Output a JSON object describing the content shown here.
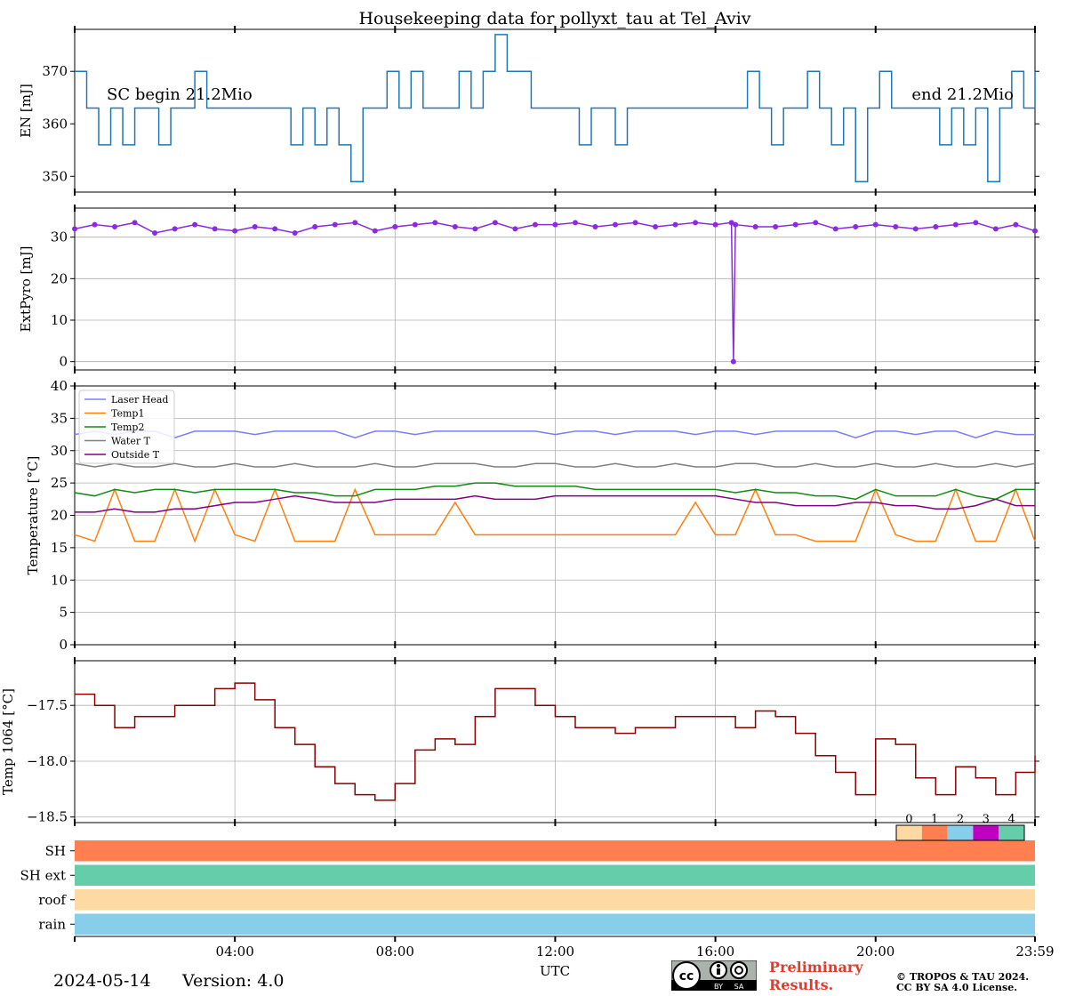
{
  "title": "Housekeeping data for pollyxt_tau at Tel_Aviv",
  "footer": {
    "date": "2024-05-14",
    "version": "Version: 4.0",
    "preliminary_line1": "Preliminary",
    "preliminary_line2": "Results.",
    "copyright_line1": "© TROPOS & TAU 2024.",
    "copyright_line2": "CC BY SA 4.0 License.",
    "license_badge": [
      "BY",
      "SA"
    ]
  },
  "colors": {
    "en": "#1f77b4",
    "pyro": "#8a2be2",
    "laser_head": "#7b7bff",
    "temp1": "#ff7f0e",
    "temp2": "#138a13",
    "water_t": "#808080",
    "outside_t": "#800080",
    "temp1064": "#8b0000",
    "status_0": "#fdd9a4",
    "status_1": "#ff7f50",
    "status_2": "#87ceeb",
    "status_3": "#c000c0",
    "status_4": "#66cdaa"
  },
  "chart_data": [
    {
      "type": "line",
      "id": "en",
      "ylabel": "EN [mJ]",
      "ylim": [
        347,
        378
      ],
      "yticks": [
        350,
        360,
        370
      ],
      "ytick_labels": [
        "350",
        "360",
        "370"
      ],
      "grid": false,
      "annotations": [
        "SC begin 21.2Mio",
        "end 21.2Mio"
      ],
      "x_hours": [
        0,
        0.3,
        0.6,
        0.9,
        1.2,
        1.5,
        1.8,
        2.1,
        2.4,
        2.7,
        3.0,
        3.3,
        3.6,
        3.9,
        4.2,
        4.5,
        4.8,
        5.1,
        5.4,
        5.7,
        6.0,
        6.3,
        6.6,
        6.9,
        7.2,
        7.5,
        7.8,
        8.1,
        8.4,
        8.7,
        9.0,
        9.3,
        9.6,
        9.9,
        10.2,
        10.5,
        10.8,
        11.1,
        11.4,
        11.7,
        12.0,
        12.3,
        12.6,
        12.9,
        13.2,
        13.5,
        13.8,
        14.1,
        14.4,
        14.7,
        15.0,
        15.3,
        15.6,
        15.9,
        16.2,
        16.5,
        16.8,
        17.1,
        17.4,
        17.7,
        18.0,
        18.3,
        18.6,
        18.9,
        19.2,
        19.5,
        19.8,
        20.1,
        20.4,
        20.7,
        21.0,
        21.3,
        21.6,
        21.9,
        22.2,
        22.5,
        22.8,
        23.1,
        23.4,
        23.7,
        23.98
      ],
      "values": [
        370,
        363,
        356,
        363,
        356,
        363,
        363,
        356,
        363,
        363,
        370,
        363,
        363,
        363,
        363,
        363,
        363,
        363,
        356,
        363,
        356,
        363,
        356,
        349,
        363,
        363,
        370,
        363,
        370,
        363,
        363,
        363,
        370,
        363,
        370,
        377,
        370,
        370,
        363,
        363,
        363,
        363,
        356,
        363,
        363,
        356,
        363,
        363,
        363,
        363,
        363,
        363,
        363,
        363,
        363,
        363,
        370,
        363,
        356,
        363,
        363,
        370,
        363,
        356,
        363,
        349,
        363,
        370,
        363,
        363,
        363,
        363,
        356,
        363,
        356,
        363,
        349,
        363,
        370,
        363,
        370
      ]
    },
    {
      "type": "scatter",
      "id": "pyro",
      "ylabel": "ExtPyro [mJ]",
      "ylim": [
        -2,
        37
      ],
      "yticks": [
        0,
        10,
        20,
        30
      ],
      "ytick_labels": [
        "0",
        "10",
        "20",
        "30"
      ],
      "grid": true,
      "x_hours": [
        0,
        0.5,
        1.0,
        1.5,
        2.0,
        2.5,
        3.0,
        3.5,
        4.0,
        4.5,
        5.0,
        5.5,
        6.0,
        6.5,
        7.0,
        7.5,
        8.0,
        8.5,
        9.0,
        9.5,
        10.0,
        10.5,
        11.0,
        11.5,
        12.0,
        12.5,
        13.0,
        13.5,
        14.0,
        14.5,
        15.0,
        15.5,
        16.0,
        16.4,
        16.45,
        16.5,
        17.0,
        17.5,
        18.0,
        18.5,
        19.0,
        19.5,
        20.0,
        20.5,
        21.0,
        21.5,
        22.0,
        22.5,
        23.0,
        23.5,
        23.98
      ],
      "values": [
        32.0,
        33.0,
        32.5,
        33.5,
        31.0,
        32.0,
        33.0,
        32.0,
        31.5,
        32.5,
        32.0,
        31.0,
        32.5,
        33.0,
        33.5,
        31.5,
        32.5,
        33.0,
        33.5,
        32.5,
        32.0,
        33.5,
        32.0,
        33.0,
        33.0,
        33.5,
        32.5,
        33.0,
        33.5,
        32.5,
        33.0,
        33.5,
        33.0,
        33.5,
        0,
        33.0,
        32.5,
        32.5,
        33.0,
        33.5,
        32.0,
        32.5,
        33.0,
        32.5,
        32.0,
        32.5,
        33.0,
        33.5,
        32.0,
        33.0,
        31.5
      ]
    },
    {
      "type": "line",
      "id": "temps",
      "ylabel": "Temperature [$^\\circ C$]",
      "ylim": [
        0,
        40
      ],
      "yticks": [
        0,
        5,
        10,
        15,
        20,
        25,
        30,
        35,
        40
      ],
      "ytick_labels": [
        "0",
        "5",
        "10",
        "15",
        "20",
        "25",
        "30",
        "35",
        "40"
      ],
      "grid": true,
      "legend": "top-left",
      "x_hours": [
        0,
        0.5,
        1.0,
        1.5,
        2.0,
        2.5,
        3.0,
        3.5,
        4.0,
        4.5,
        5.0,
        5.5,
        6.0,
        6.5,
        7.0,
        7.5,
        8.0,
        8.5,
        9.0,
        9.5,
        10.0,
        10.5,
        11.0,
        11.5,
        12.0,
        12.5,
        13.0,
        13.5,
        14.0,
        14.5,
        15.0,
        15.5,
        16.0,
        16.5,
        17.0,
        17.5,
        18.0,
        18.5,
        19.0,
        19.5,
        20.0,
        20.5,
        21.0,
        21.5,
        22.0,
        22.5,
        23.0,
        23.5,
        23.98
      ],
      "series": [
        {
          "name": "Laser Head",
          "color_key": "laser_head",
          "values": [
            32.5,
            33,
            32.5,
            33,
            33,
            32,
            33,
            33,
            33,
            32.5,
            33,
            33,
            33,
            33,
            32,
            33,
            33,
            32.5,
            33,
            33,
            33,
            33,
            33,
            33,
            32.5,
            33,
            33,
            32.5,
            33,
            33,
            33,
            32.5,
            33,
            33,
            32.5,
            33,
            33,
            33,
            33,
            32,
            33,
            33,
            32.5,
            33,
            33,
            32,
            33,
            32.5,
            32.5
          ]
        },
        {
          "name": "Temp1",
          "color_key": "temp1",
          "values": [
            17,
            16,
            24,
            16,
            16,
            24,
            16,
            24,
            17,
            16,
            24,
            16,
            16,
            16,
            24,
            17,
            17,
            17,
            17,
            22,
            17,
            17,
            17,
            17,
            17,
            17,
            17,
            17,
            17,
            17,
            17,
            22,
            17,
            17,
            24,
            17,
            17,
            16,
            16,
            16,
            24,
            17,
            16,
            16,
            24,
            16,
            16,
            24,
            16
          ]
        },
        {
          "name": "Temp2",
          "color_key": "temp2",
          "values": [
            23.5,
            23,
            24,
            23.5,
            24,
            24,
            23.5,
            24,
            24,
            24,
            24,
            23.5,
            23.5,
            23,
            23,
            24,
            24,
            24,
            24.5,
            24.5,
            25,
            25,
            24.5,
            24.5,
            24.5,
            24.5,
            24,
            24,
            24,
            24,
            24,
            24,
            24,
            23.5,
            24,
            23.5,
            23.5,
            23,
            23,
            22.5,
            24,
            23,
            23,
            23,
            24,
            23,
            22.5,
            24,
            24
          ]
        },
        {
          "name": "Water T",
          "color_key": "water_t",
          "values": [
            28,
            27.5,
            28,
            27.5,
            27.5,
            28,
            27.5,
            27.5,
            28,
            27.5,
            27.5,
            28,
            27.5,
            27.5,
            27.5,
            28,
            27.5,
            27.5,
            28,
            28,
            28,
            27.5,
            27.5,
            28,
            28,
            27.5,
            27.5,
            28,
            27.5,
            27.5,
            28,
            27.5,
            27.5,
            28,
            28,
            27.5,
            27.5,
            28,
            27.5,
            27.5,
            28,
            27.5,
            27.5,
            28,
            27.5,
            27.5,
            28,
            27.5,
            28
          ]
        },
        {
          "name": "Outside T",
          "color_key": "outside_t",
          "values": [
            20.5,
            20.5,
            21,
            20.5,
            20.5,
            21,
            21,
            21.5,
            22,
            22,
            22.5,
            23,
            22.5,
            22,
            22,
            22,
            22.5,
            22.5,
            22.5,
            22.5,
            23,
            22.5,
            22.5,
            22.5,
            23,
            23,
            23,
            23,
            23,
            23,
            23,
            23,
            23,
            22.5,
            22,
            22,
            21.5,
            21.5,
            21.5,
            22,
            22,
            21.5,
            21.5,
            21,
            21,
            21.5,
            22.5,
            21.5,
            21.5
          ]
        }
      ]
    },
    {
      "type": "line",
      "id": "t1064",
      "ylabel": "Temp 1064 [$^\\circ C$]",
      "ylim": [
        -18.55,
        -17.1
      ],
      "yticks": [
        -18.5,
        -18.0,
        -17.5
      ],
      "ytick_labels": [
        "−18.5",
        "−18.0",
        "−17.5"
      ],
      "grid": true,
      "x_hours": [
        0,
        0.5,
        1.0,
        1.5,
        2.0,
        2.5,
        3.0,
        3.5,
        4.0,
        4.5,
        5.0,
        5.5,
        6.0,
        6.5,
        7.0,
        7.5,
        8.0,
        8.5,
        9.0,
        9.5,
        10.0,
        10.5,
        11.0,
        11.5,
        12.0,
        12.5,
        13.0,
        13.5,
        14.0,
        14.5,
        15.0,
        15.5,
        16.0,
        16.5,
        17.0,
        17.5,
        18.0,
        18.5,
        19.0,
        19.5,
        20.0,
        20.5,
        21.0,
        21.5,
        22.0,
        22.5,
        23.0,
        23.5,
        23.98
      ],
      "values": [
        -17.4,
        -17.5,
        -17.7,
        -17.6,
        -17.6,
        -17.5,
        -17.5,
        -17.35,
        -17.3,
        -17.45,
        -17.7,
        -17.85,
        -18.05,
        -18.2,
        -18.3,
        -18.35,
        -18.2,
        -17.9,
        -17.8,
        -17.85,
        -17.6,
        -17.35,
        -17.35,
        -17.5,
        -17.6,
        -17.7,
        -17.7,
        -17.75,
        -17.7,
        -17.7,
        -17.6,
        -17.6,
        -17.6,
        -17.7,
        -17.55,
        -17.6,
        -17.75,
        -17.95,
        -18.1,
        -18.3,
        -17.8,
        -17.85,
        -18.15,
        -18.3,
        -18.05,
        -18.15,
        -18.3,
        -18.1,
        -17.95
      ]
    },
    {
      "type": "heatmap",
      "id": "status",
      "rows": [
        "SH",
        "SH ext",
        "roof",
        "rain"
      ],
      "row_values": [
        1,
        4,
        0,
        2
      ],
      "colorbar_labels": [
        "0",
        "1",
        "2",
        "3",
        "4"
      ],
      "xlabel": "UTC",
      "xlim_hours": [
        0,
        23.98
      ],
      "xticks_hours": [
        4,
        8,
        12,
        16,
        20,
        23.98
      ],
      "xtick_labels": [
        "04:00",
        "08:00",
        "12:00",
        "16:00",
        "20:00",
        "23:59"
      ]
    }
  ]
}
